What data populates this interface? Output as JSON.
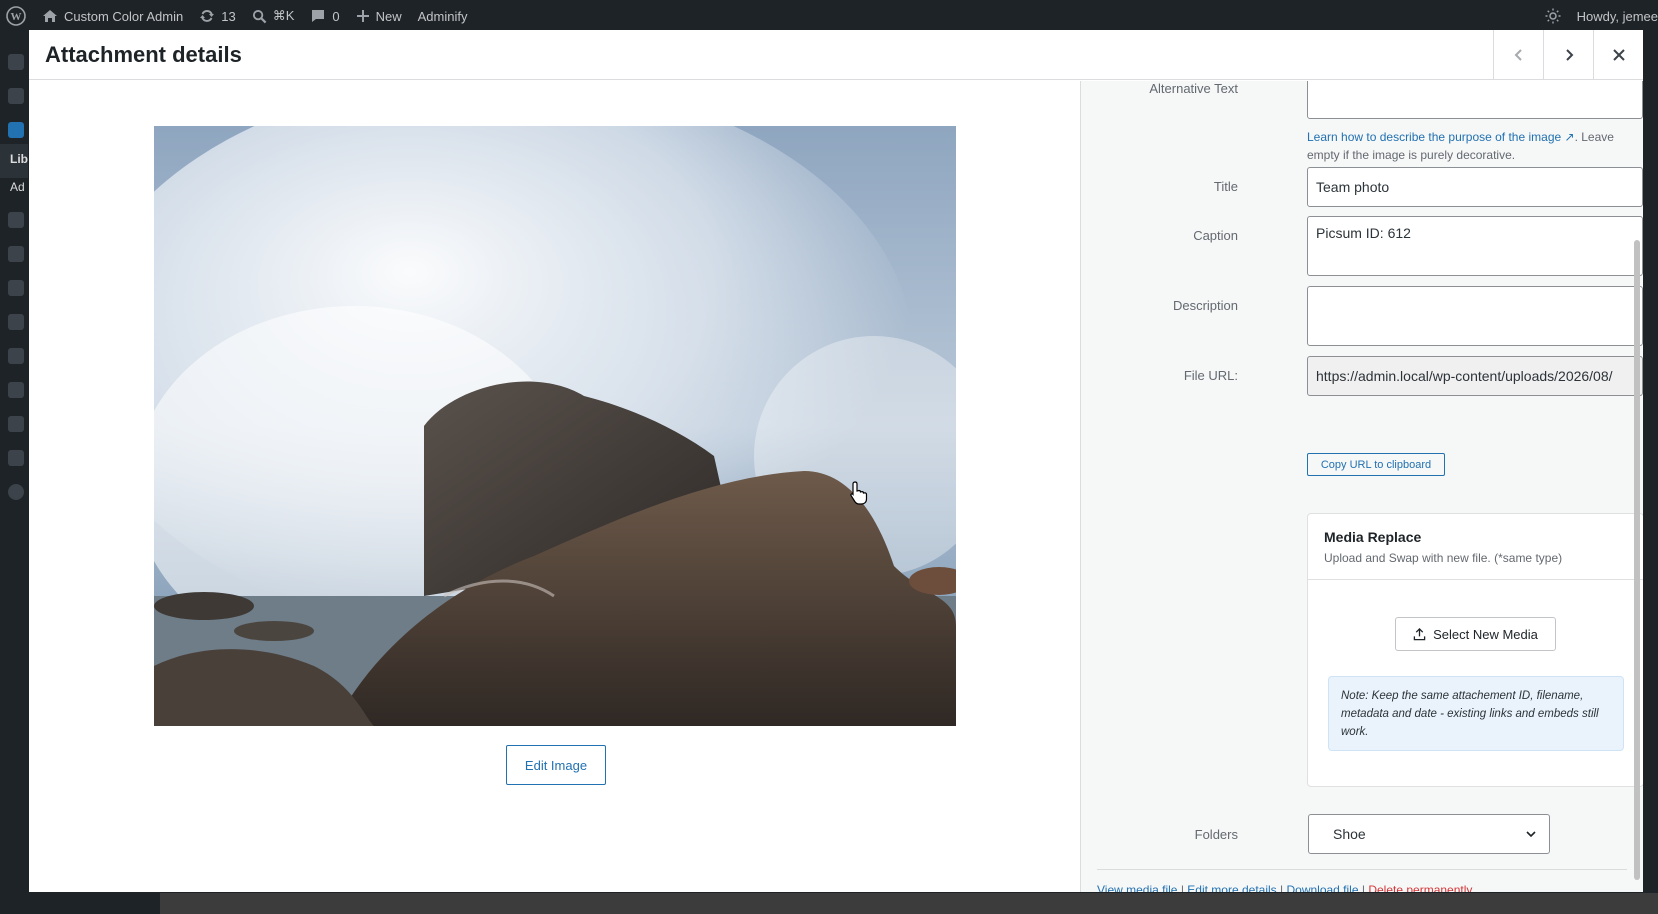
{
  "admin_bar": {
    "site_name": "Custom Color Admin",
    "updates_count": "13",
    "search_shortcut": "⌘K",
    "comments_count": "0",
    "new_label": "New",
    "plugin_label": "Adminify",
    "greeting": "Howdy, jemee"
  },
  "left_menu": {
    "partial_labels": [
      "Lib",
      "Ad"
    ]
  },
  "modal": {
    "title": "Attachment details",
    "edit_image_label": "Edit Image"
  },
  "details": {
    "alt_text_label": "Alternative Text",
    "alt_text_value": "",
    "alt_help_link": "Learn how to describe the purpose of the image",
    "alt_help_rest": ". Leave empty if the image is purely decorative.",
    "title_label": "Title",
    "title_value": "Team photo",
    "caption_label": "Caption",
    "caption_value": "Picsum ID: 612",
    "description_label": "Description",
    "description_value": "",
    "file_url_label": "File URL:",
    "file_url_value": "https://admin.local/wp-content/uploads/2026/08/",
    "copy_url_label": "Copy URL to clipboard"
  },
  "media_replace": {
    "title": "Media Replace",
    "subtitle": "Upload and Swap with new file. (*same type)",
    "select_label": "Select New Media",
    "note": "Note: Keep the same attachement ID, filename, metadata and date - existing links and embeds still work."
  },
  "folders": {
    "label": "Folders",
    "selected": "Shoe"
  },
  "actions": {
    "view": "View media file",
    "edit_more": "Edit more details",
    "download": "Download file",
    "delete": "Delete permanently",
    "separator": "|"
  },
  "colors": {
    "accent": "#2271b1",
    "danger": "#d63638",
    "adminbar": "#1d2327"
  }
}
